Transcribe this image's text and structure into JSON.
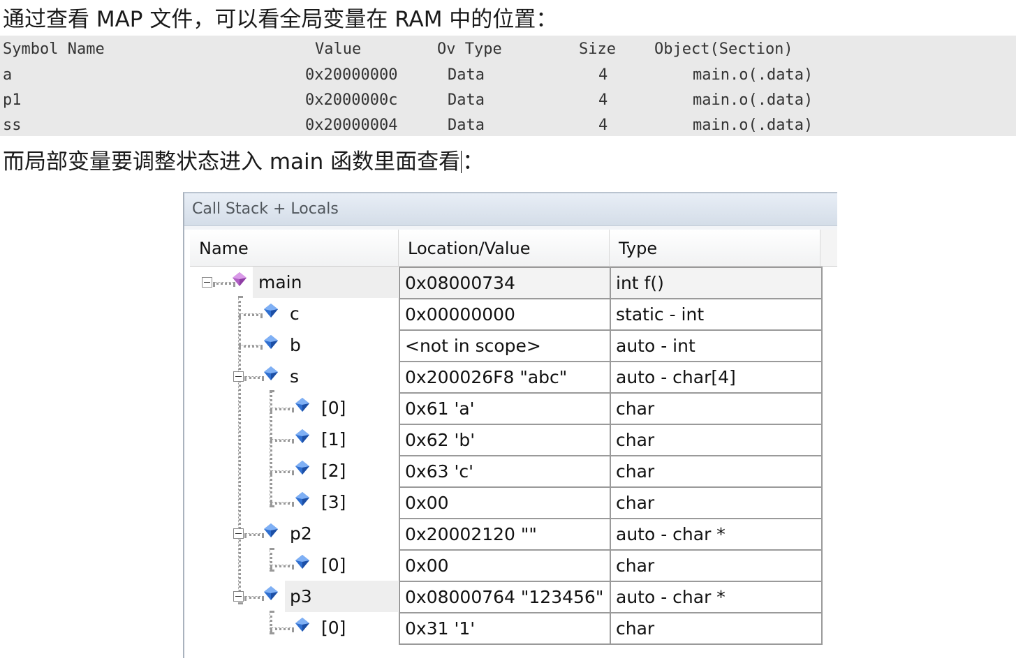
{
  "intro_text": "通过查看 MAP 文件，可以看全局变量在 RAM 中的位置：",
  "map_table": {
    "headers": {
      "symbol": "Symbol Name",
      "value": "Value",
      "ov_type": "Ov Type",
      "size": "Size",
      "object": "Object(Section)"
    },
    "rows": [
      {
        "symbol": "a",
        "value": "0x20000000",
        "ov_type": "Data",
        "size": "4",
        "object": "main.o(.data)"
      },
      {
        "symbol": "p1",
        "value": "0x2000000c",
        "ov_type": "Data",
        "size": "4",
        "object": "main.o(.data)"
      },
      {
        "symbol": "ss",
        "value": "0x20000004",
        "ov_type": "Data",
        "size": "4",
        "object": "main.o(.data)"
      }
    ]
  },
  "locals_text_before": "而局部变量要调整状态进入 main 函数里面查看",
  "locals_text_after": "：",
  "window": {
    "title": "Call Stack + Locals",
    "columns": {
      "name": "Name",
      "location": "Location/Value",
      "type": "Type"
    },
    "rows": [
      {
        "name": "main",
        "location": "0x08000734",
        "type": "int f()",
        "icon": "function-icon",
        "expanded": true,
        "selected": true
      },
      {
        "name": "c",
        "location": "0x00000000",
        "type": "static - int",
        "icon": "variable-icon"
      },
      {
        "name": "b",
        "location": "<not in scope>",
        "type": "auto - int",
        "icon": "variable-icon"
      },
      {
        "name": "s",
        "location": "0x200026F8 \"abc\"",
        "type": "auto - char[4]",
        "icon": "variable-icon",
        "expanded": true
      },
      {
        "name": "[0]",
        "location": "0x61 'a'",
        "type": "char",
        "icon": "variable-icon"
      },
      {
        "name": "[1]",
        "location": "0x62 'b'",
        "type": "char",
        "icon": "variable-icon"
      },
      {
        "name": "[2]",
        "location": "0x63 'c'",
        "type": "char",
        "icon": "variable-icon"
      },
      {
        "name": "[3]",
        "location": "0x00",
        "type": "char",
        "icon": "variable-icon"
      },
      {
        "name": "p2",
        "location": "0x20002120 \"\"",
        "type": "auto - char *",
        "icon": "variable-icon",
        "expanded": true
      },
      {
        "name": "[0]",
        "location": "0x00",
        "type": "char",
        "icon": "variable-icon"
      },
      {
        "name": "p3",
        "location": "0x08000764 \"123456\"",
        "type": "auto - char *",
        "icon": "variable-icon",
        "expanded": true,
        "selected": true
      },
      {
        "name": "[0]",
        "location": "0x31 '1'",
        "type": "char",
        "icon": "variable-icon"
      }
    ]
  },
  "colors": {
    "function_icon": "#b05fc4",
    "variable_icon": "#2f6fd0",
    "grid_line": "#9a9a9a",
    "title_bar": "#d4dde8"
  }
}
